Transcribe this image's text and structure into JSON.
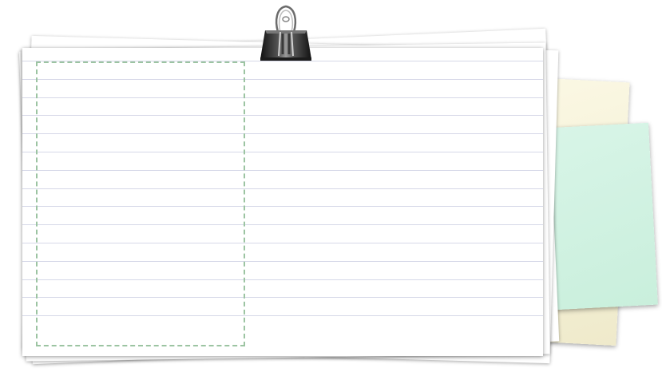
{
  "colors": {
    "background": "#ffffff",
    "card": "#ffffff",
    "rule_line": "#d6d8e8",
    "dashed_box": "#9cc4a2",
    "note_yellow": "#f6f2d8",
    "note_green": "#d2f2e2",
    "clip": "#2a2a2a"
  },
  "icons": {
    "clip": "binder-clip-icon"
  },
  "card": {
    "rule_count": 15
  }
}
